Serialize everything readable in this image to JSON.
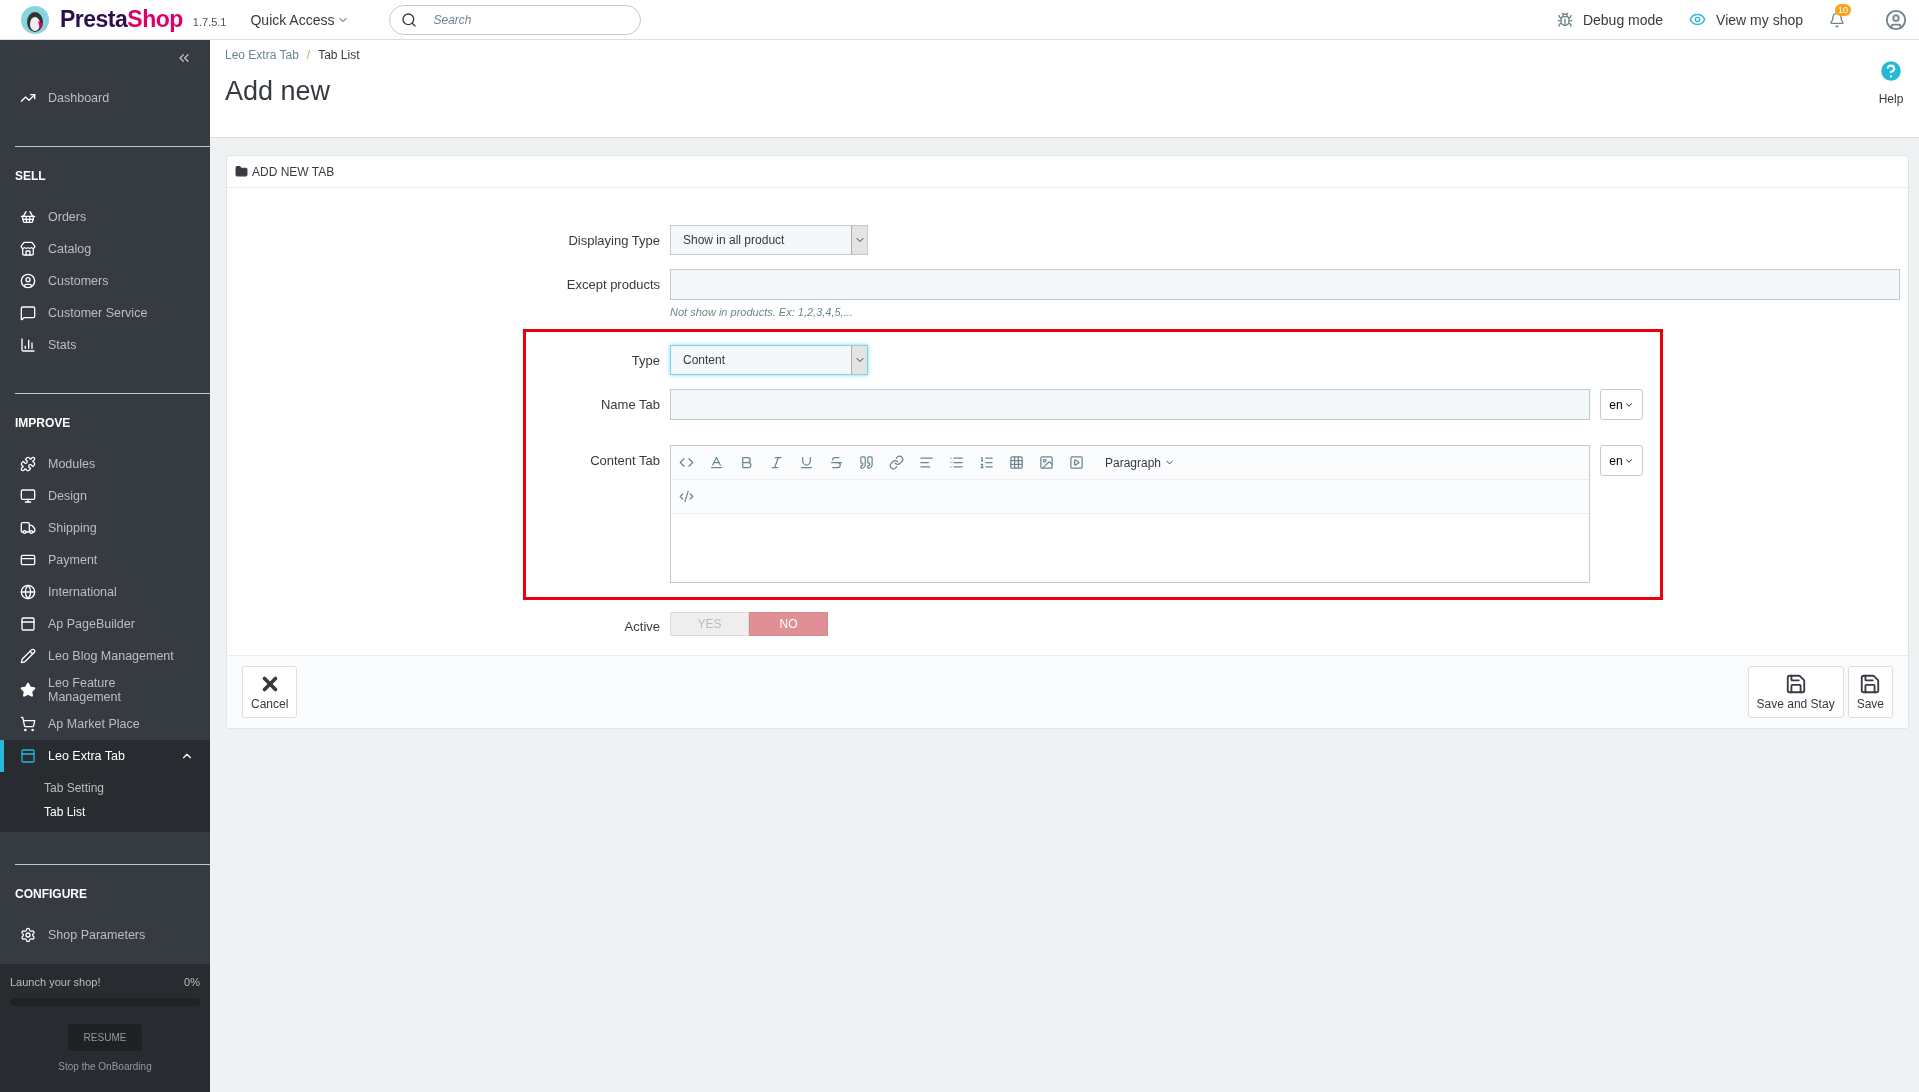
{
  "header": {
    "brand": [
      "Presta",
      "Shop"
    ],
    "version": "1.7.5.1",
    "quick_access": "Quick Access",
    "search": {
      "placeholder": "Search"
    },
    "debug": "Debug mode",
    "view_shop": "View my shop",
    "notifications": "10"
  },
  "sidebar": {
    "dashboard": {
      "label": "Dashboard",
      "selected": false
    },
    "sections": [
      {
        "title": "SELL",
        "items": [
          {
            "label": "Orders",
            "selected": false
          },
          {
            "label": "Catalog",
            "selected": false
          },
          {
            "label": "Customers",
            "selected": false
          },
          {
            "label": "Customer Service",
            "selected": false
          },
          {
            "label": "Stats",
            "selected": false
          }
        ]
      },
      {
        "title": "IMPROVE",
        "items": [
          {
            "label": "Modules",
            "selected": false
          },
          {
            "label": "Design",
            "selected": false
          },
          {
            "label": "Shipping",
            "selected": false
          },
          {
            "label": "Payment",
            "selected": false
          },
          {
            "label": "International",
            "selected": false
          },
          {
            "label": "Ap PageBuilder",
            "selected": false
          },
          {
            "label": "Leo Blog Management",
            "selected": false
          },
          {
            "label": "Leo Feature Management",
            "selected": false
          },
          {
            "label": "Ap Market Place",
            "selected": false
          },
          {
            "label": "Leo Extra Tab",
            "selected": true,
            "expanded": true,
            "children": [
              {
                "label": "Tab Setting",
                "selected": false
              },
              {
                "label": "Tab List",
                "selected": true
              }
            ]
          }
        ]
      },
      {
        "title": "CONFIGURE",
        "items": [
          {
            "label": "Shop Parameters",
            "selected": false
          }
        ]
      }
    ],
    "onboarding": {
      "title": "Launch your shop!",
      "percent": "0%",
      "level": 0,
      "button": "RESUME",
      "stop": "Stop the OnBoarding"
    }
  },
  "breadcrumb": [
    "Leo Extra Tab",
    "Tab List"
  ],
  "breadcrumb_separator": "/",
  "page_title": "Add new",
  "help": "Help",
  "panel": {
    "title": "ADD NEW TAB",
    "fields": [
      {
        "kind": "select",
        "label": "Displaying Type",
        "value": "Show in all product",
        "focused": false
      },
      {
        "kind": "text",
        "label": "Except products",
        "help": "Not show in products. Ex: 1,2,3,4,5,..."
      },
      {
        "kind": "select",
        "label": "Type",
        "value": "Content",
        "focused": true,
        "highlight_start": true
      },
      {
        "kind": "text",
        "label": "Name Tab",
        "lang": "en"
      },
      {
        "kind": "editor",
        "label": "Content Tab",
        "lang": "en",
        "format": "Paragraph",
        "highlight_end": true
      },
      {
        "kind": "toggle",
        "label": "Active",
        "options": [
          {
            "label": "YES",
            "selected": false
          },
          {
            "label": "NO",
            "selected": true
          }
        ]
      }
    ],
    "footer": {
      "cancel": "Cancel",
      "save_stay": "Save and Stay",
      "save": "Save"
    }
  }
}
